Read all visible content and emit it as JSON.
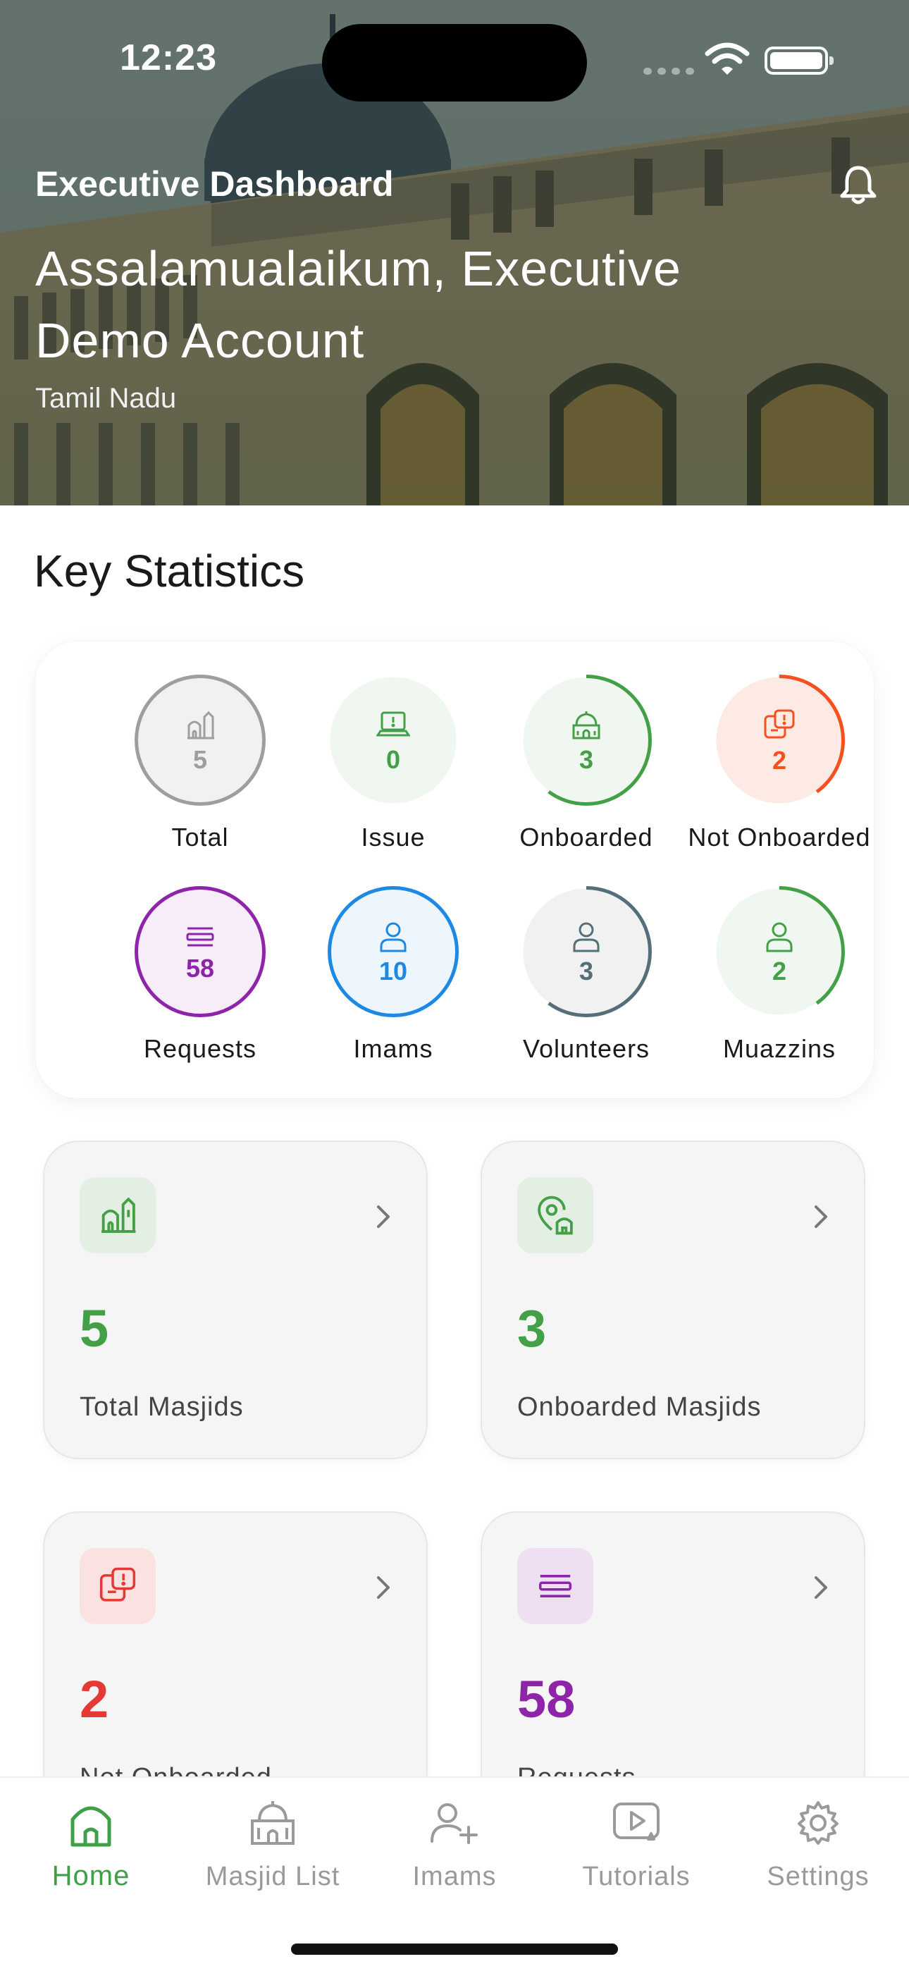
{
  "status_bar": {
    "time": "12:23"
  },
  "header": {
    "title": "Executive Dashboard",
    "greeting": "Assalamualaikum, Executive Demo Account",
    "region": "Tamil Nadu"
  },
  "key_statistics": {
    "title": "Key Statistics",
    "items": [
      {
        "label": "Total",
        "value": "5",
        "color": "#9e9e9e",
        "progress": 1.0,
        "icon": "mosque-icon"
      },
      {
        "label": "Issue",
        "value": "0",
        "color": "#43a047",
        "progress": 0.0,
        "icon": "laptop-alert-icon"
      },
      {
        "label": "Onboarded",
        "value": "3",
        "color": "#43a047",
        "progress": 0.6,
        "icon": "masjid-dome-icon"
      },
      {
        "label": "Not Onboarded",
        "value": "2",
        "color": "#f4511e",
        "progress": 0.4,
        "icon": "chat-alert-icon"
      },
      {
        "label": "Requests",
        "value": "58",
        "color": "#8e24aa",
        "progress": 1.0,
        "icon": "list-icon"
      },
      {
        "label": "Imams",
        "value": "10",
        "color": "#1e88e5",
        "progress": 1.0,
        "icon": "person-icon"
      },
      {
        "label": "Volunteers",
        "value": "3",
        "color": "#546e7a",
        "progress": 0.6,
        "icon": "person-icon"
      },
      {
        "label": "Muazzins",
        "value": "2",
        "color": "#43a047",
        "progress": 0.4,
        "icon": "person-icon"
      }
    ]
  },
  "tiles": [
    {
      "value": "5",
      "caption": "Total Masjids",
      "color": "#43a047",
      "icon": "mosque-icon"
    },
    {
      "value": "3",
      "caption": "Onboarded Masjids",
      "color": "#43a047",
      "icon": "masjid-location-icon"
    },
    {
      "value": "2",
      "caption": "Not Onboarded",
      "color": "#e53935",
      "icon": "chat-alert-icon"
    },
    {
      "value": "58",
      "caption": "Requests",
      "color": "#8e24aa",
      "icon": "list-icon"
    }
  ],
  "tabbar": {
    "items": [
      {
        "label": "Home",
        "icon": "home-icon",
        "active": true
      },
      {
        "label": "Masjid List",
        "icon": "masjid-icon",
        "active": false
      },
      {
        "label": "Imams",
        "icon": "add-person-icon",
        "active": false
      },
      {
        "label": "Tutorials",
        "icon": "video-icon",
        "active": false
      },
      {
        "label": "Settings",
        "icon": "gear-icon",
        "active": false
      }
    ]
  }
}
